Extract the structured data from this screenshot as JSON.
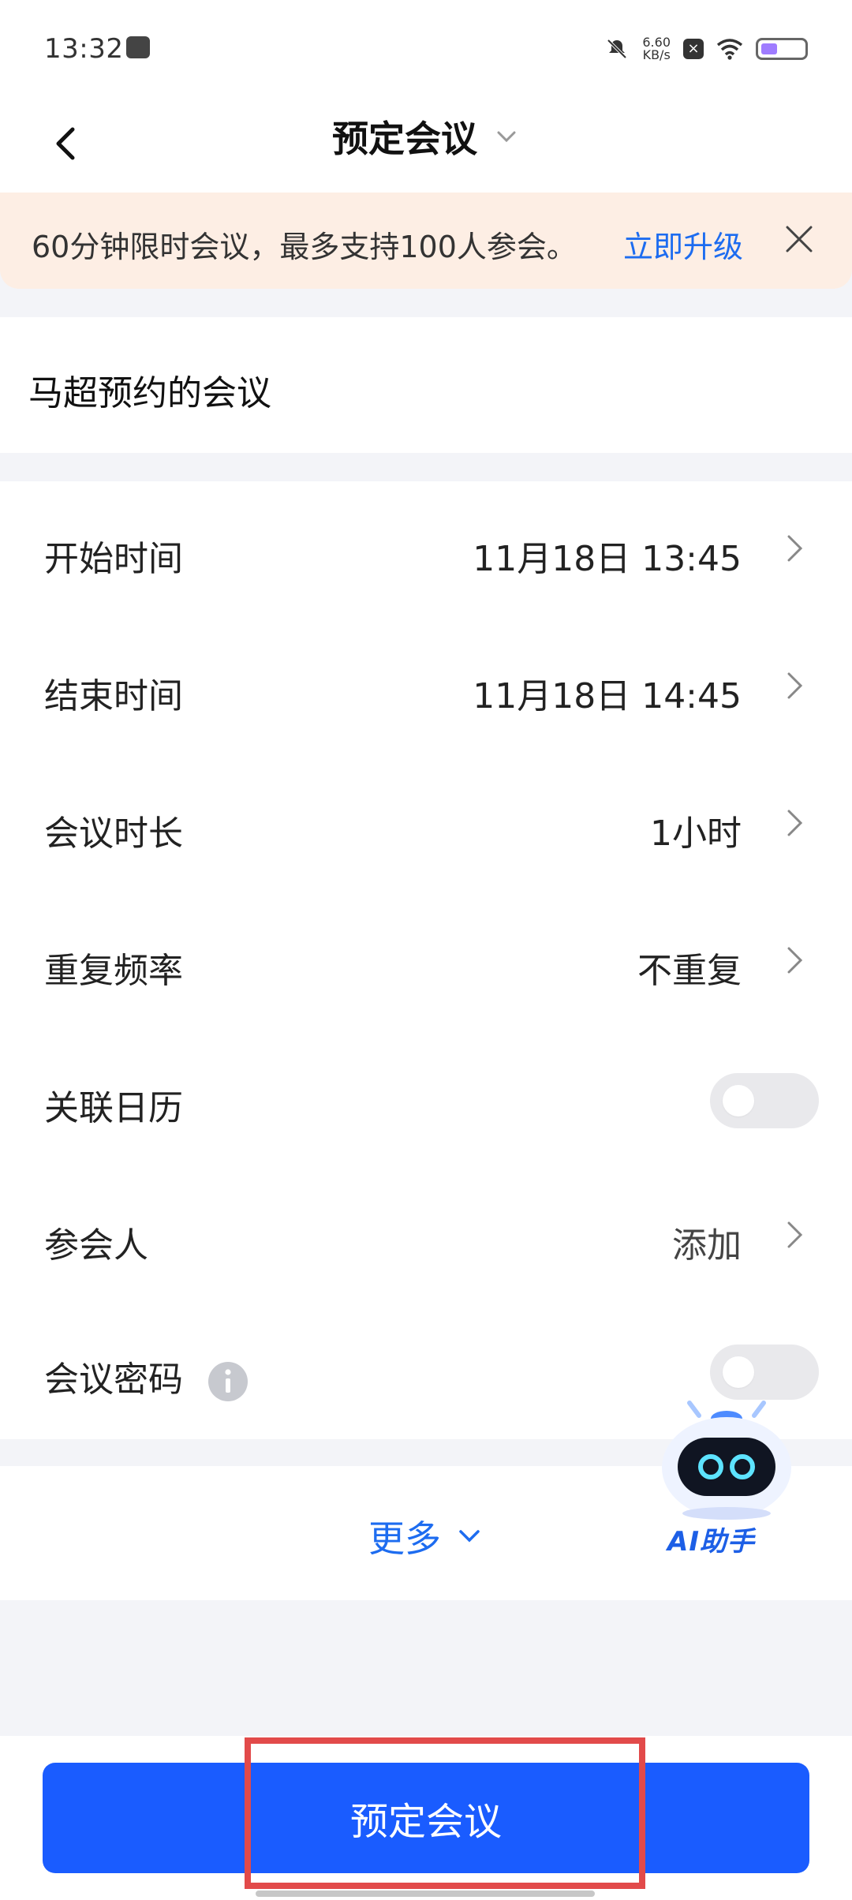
{
  "status_bar": {
    "time": "13:32",
    "net_speed_value": "6.60",
    "net_speed_unit": "KB/s"
  },
  "header": {
    "title": "预定会议"
  },
  "banner": {
    "text": "60分钟限时会议，最多支持100人参会。",
    "link": "立即升级"
  },
  "meeting": {
    "name": "马超预约的会议"
  },
  "settings": {
    "start_time": {
      "label": "开始时间",
      "value": "11月18日 13:45"
    },
    "end_time": {
      "label": "结束时间",
      "value": "11月18日 14:45"
    },
    "duration": {
      "label": "会议时长",
      "value": "1小时"
    },
    "repeat": {
      "label": "重复频率",
      "value": "不重复"
    },
    "calendar": {
      "label": "关联日历",
      "enabled": false
    },
    "participants": {
      "label": "参会人",
      "value": "添加"
    },
    "password": {
      "label": "会议密码",
      "enabled": false
    }
  },
  "more": {
    "label": "更多"
  },
  "ai_helper": {
    "label": "AI助手"
  },
  "primary_action": {
    "label": "预定会议"
  },
  "colors": {
    "accent": "#1a5cff",
    "link": "#1d6cf0",
    "banner_bg": "#fdeee4",
    "highlight": "#e24a4a"
  }
}
